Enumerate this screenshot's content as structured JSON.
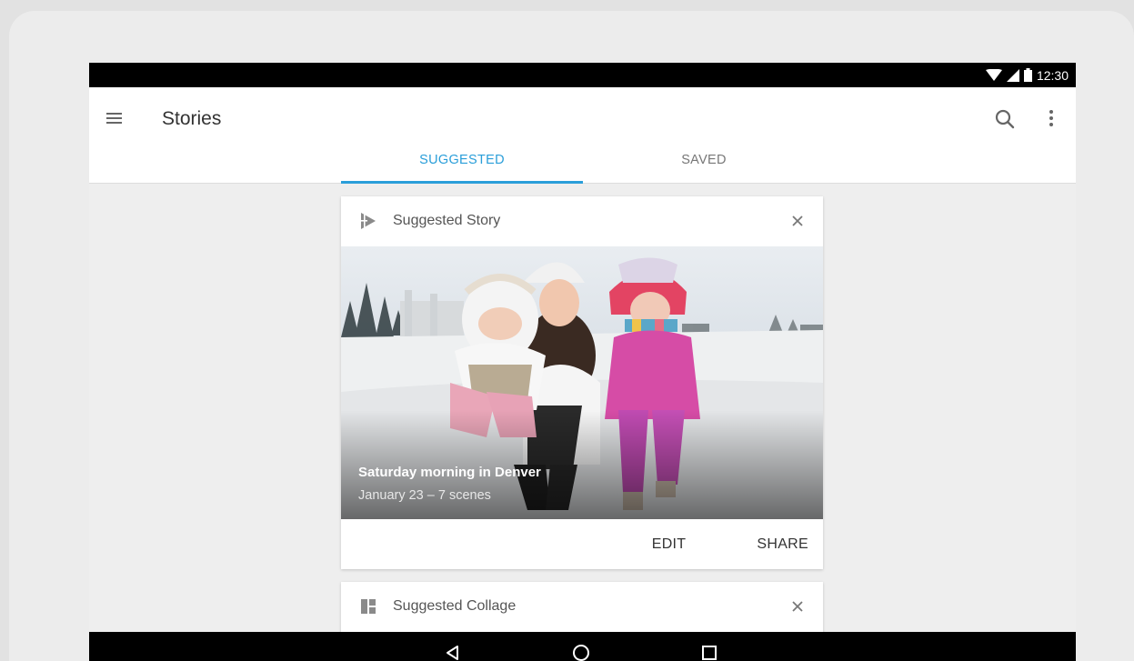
{
  "status_bar": {
    "time": "12:30"
  },
  "app_bar": {
    "title": "Stories"
  },
  "tabs": [
    {
      "label": "SUGGESTED",
      "active": true
    },
    {
      "label": "SAVED",
      "active": false
    }
  ],
  "cards": {
    "story": {
      "title": "Suggested Story",
      "photo_title": "Saturday morning in Denver",
      "photo_subtitle": "January 23 – 7 scenes",
      "actions": {
        "edit": "EDIT",
        "share": "SHARE"
      }
    },
    "collage": {
      "title": "Suggested Collage"
    }
  },
  "colors": {
    "accent": "#2a9ed9",
    "status_bar": "#000000",
    "nav_bar": "#000000"
  },
  "icons": [
    "wifi-icon",
    "signal-icon",
    "battery-icon",
    "menu-icon",
    "search-icon",
    "more-vert-icon",
    "story-icon",
    "close-icon",
    "collage-icon",
    "back-icon",
    "home-icon",
    "recents-icon"
  ]
}
